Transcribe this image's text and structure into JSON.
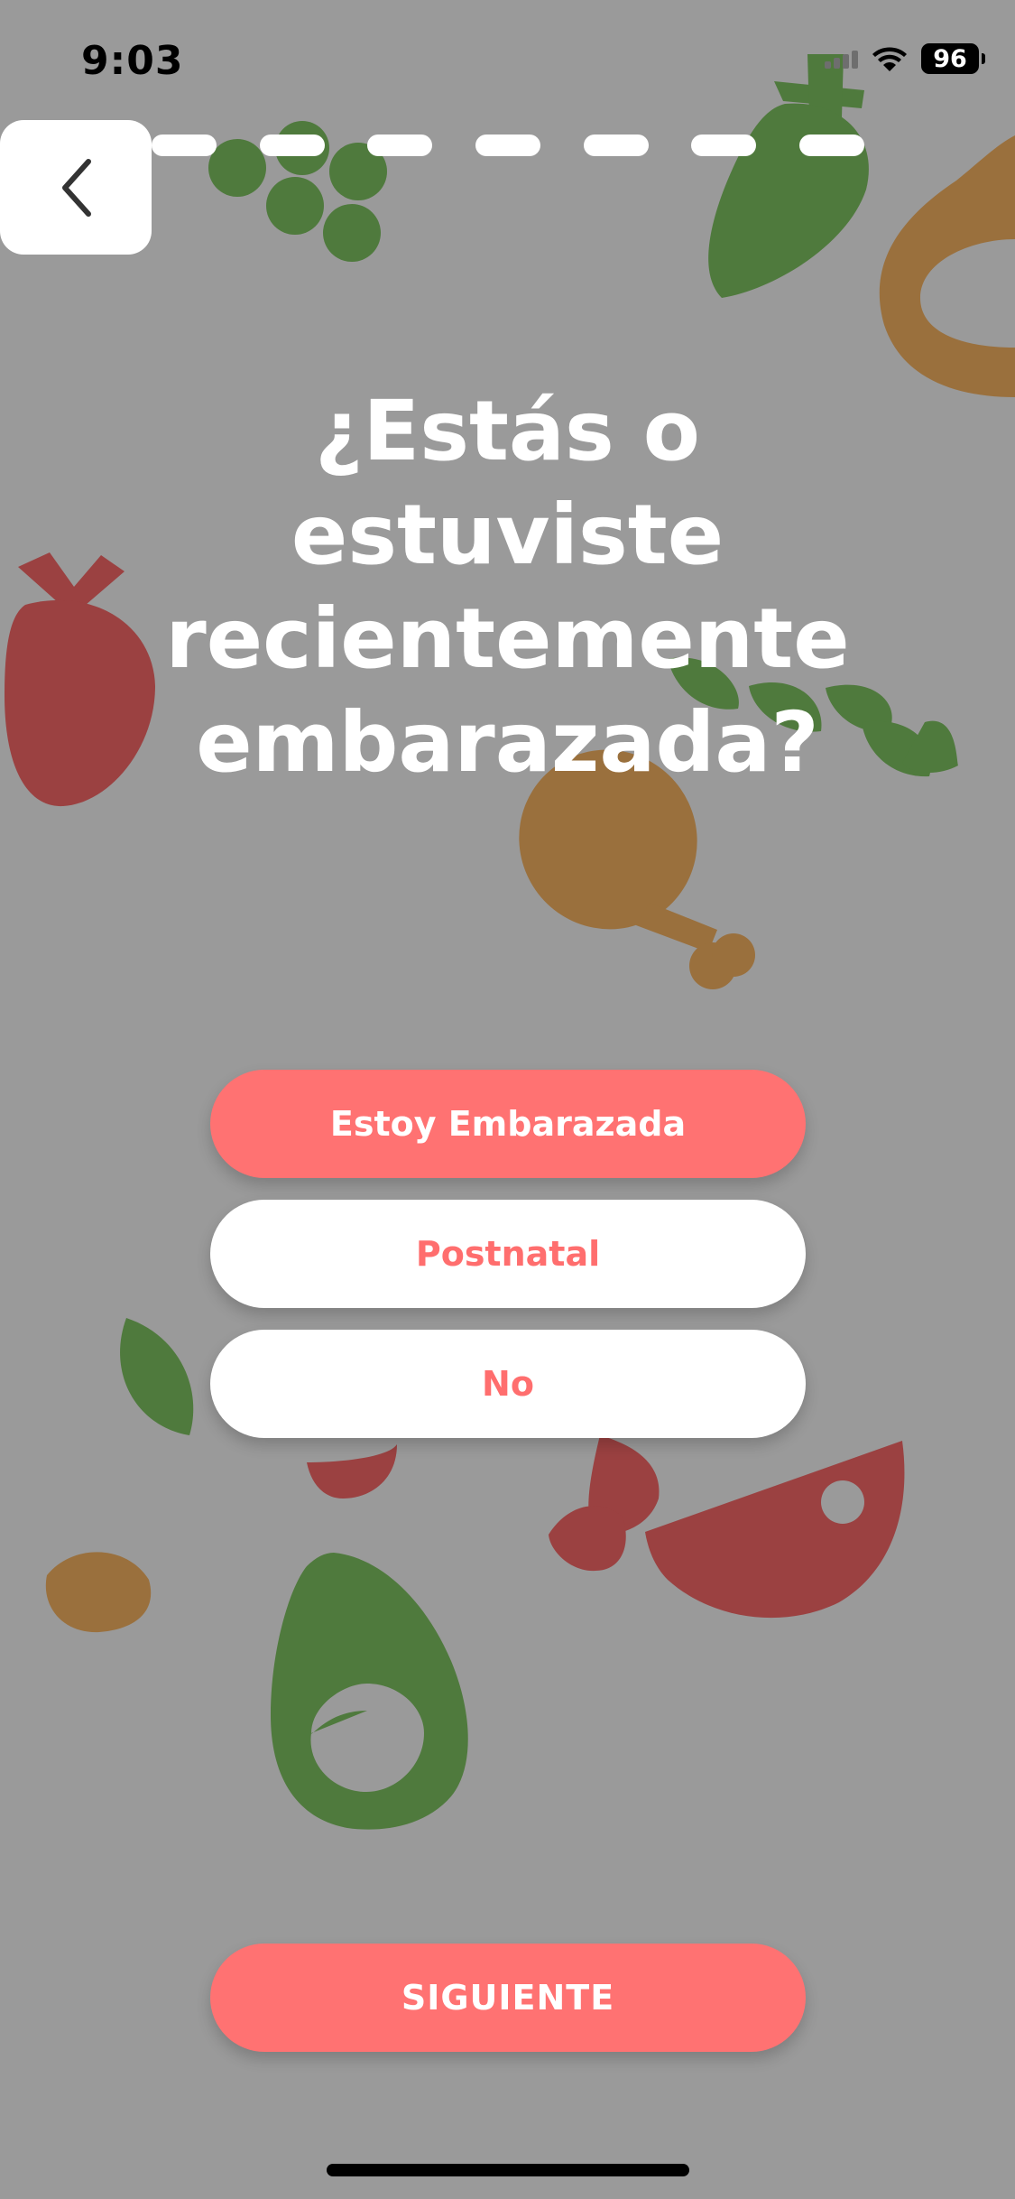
{
  "status_bar": {
    "time": "9:03",
    "battery": "96",
    "icons": [
      "cellular-signal-icon",
      "wifi-icon",
      "battery-icon"
    ]
  },
  "nav": {
    "back_icon": "chevron-left-icon",
    "progress_segments": 7
  },
  "question": {
    "title": "¿Estás o estuviste recientemente embarazada?"
  },
  "options": [
    {
      "label": "Estoy Embarazada",
      "selected": true
    },
    {
      "label": "Postnatal",
      "selected": false
    },
    {
      "label": "No",
      "selected": false
    }
  ],
  "next_button": {
    "label": "SIGUIENTE"
  },
  "colors": {
    "background": "#9a9a9a",
    "accent": "#ff7272",
    "green": "#4f7a3d",
    "red": "#9b4141",
    "brown": "#9a703d"
  }
}
